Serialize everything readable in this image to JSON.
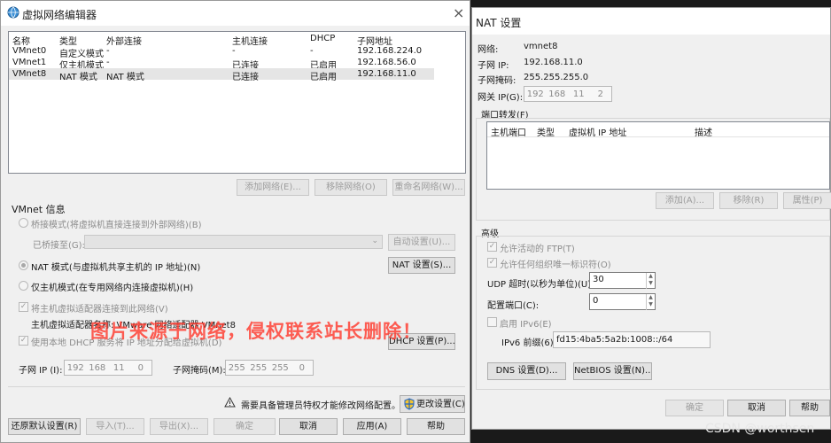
{
  "left_window": {
    "title": "虚拟网络编辑器",
    "close_glyph": "×",
    "table": {
      "headers": [
        "名称",
        "类型",
        "外部连接",
        "主机连接",
        "DHCP",
        "子网地址"
      ],
      "rows": [
        [
          "VMnet0",
          "自定义模式",
          "-",
          "-",
          "-",
          "192.168.224.0"
        ],
        [
          "VMnet1",
          "仅主机模式",
          "-",
          "已连接",
          "已启用",
          "192.168.56.0"
        ],
        [
          "VMnet8",
          "NAT 模式",
          "NAT 模式",
          "已连接",
          "已启用",
          "192.168.11.0"
        ]
      ]
    },
    "buttons": {
      "add_network": "添加网络(E)...",
      "remove_network": "移除网络(O)",
      "rename_network": "重命名网络(W)..."
    },
    "vmnet_info": {
      "section_label": "VMnet 信息",
      "bridged_label": "桥接模式(将虚拟机直接连接到外部网络)(B)",
      "bridged_to_label": "已桥接至(G):",
      "auto_settings": "自动设置(U)...",
      "nat_label": "NAT 模式(与虚拟机共享主机的 IP 地址)(N)",
      "nat_settings": "NAT 设置(S)...",
      "host_only_label": "仅主机模式(在专用网络内连接虚拟机)(H)",
      "connect_adapter_label": "将主机虚拟适配器连接到此网络(V)",
      "adapter_name_label": "主机虚拟适配器名称: VMware 网络适配器 VMnet8",
      "dhcp_label": "使用本地 DHCP 服务将 IP 地址分配给虚拟机(D)",
      "dhcp_settings": "DHCP 设置(P)...",
      "subnet_ip_label": "子网 IP (I):",
      "subnet_ip": [
        "192",
        "168",
        "11",
        "0"
      ],
      "subnet_mask_label": "子网掩码(M):",
      "subnet_mask": [
        "255",
        "255",
        "255",
        "0"
      ]
    },
    "admin_notice": "需要具备管理员特权才能修改网络配置。",
    "change_settings": "更改设置(C)",
    "footer": {
      "restore": "还原默认设置(R)",
      "import": "导入(T)...",
      "export": "导出(X)...",
      "ok": "确定",
      "cancel": "取消",
      "apply": "应用(A)",
      "help": "帮助"
    }
  },
  "right_window": {
    "title": "NAT 设置",
    "network_label": "网络:",
    "network_value": "vmnet8",
    "subnet_ip_label": "子网 IP:",
    "subnet_ip_value": "192.168.11.0",
    "subnet_mask_label": "子网掩码:",
    "subnet_mask_value": "255.255.255.0",
    "gateway_label": "网关 IP(G):",
    "gateway_ip": [
      "192",
      "168",
      "11",
      "2"
    ],
    "port_forwarding_label": "端口转发(F)",
    "port_table_headers": [
      "主机端口",
      "类型",
      "虚拟机 IP 地址",
      "描述"
    ],
    "port_buttons": {
      "add": "添加(A)...",
      "remove": "移除(R)",
      "properties": "属性(P)"
    },
    "advanced_label": "高级",
    "allow_ftp_label": "允许活动的 FTP(T)",
    "allow_oui_label": "允许任何组织唯一标识符(O)",
    "udp_timeout_label": "UDP 超时(以秒为单位)(U):",
    "udp_timeout_value": "30",
    "config_port_label": "配置端口(C):",
    "config_port_value": "0",
    "enable_ipv6_label": "启用 IPv6(E)",
    "ipv6_prefix_label": "IPv6 前缀(6):",
    "ipv6_prefix_value": "fd15:4ba5:5a2b:1008::/64",
    "dns_settings": "DNS 设置(D)...",
    "netbios_settings": "NetBIOS 设置(N)...",
    "footer": {
      "ok": "确定",
      "cancel": "取消",
      "help": "帮助"
    }
  },
  "overlay": {
    "watermark": "图片来源于网络，侵权联系站长删除！",
    "csdn": "CSDN @worthsen"
  },
  "colors": {
    "dialog_bg": "#f0f0f0",
    "accent": "#0078d7",
    "watermark": "#ff3b2f",
    "selected_row": "#e5e5e5"
  }
}
